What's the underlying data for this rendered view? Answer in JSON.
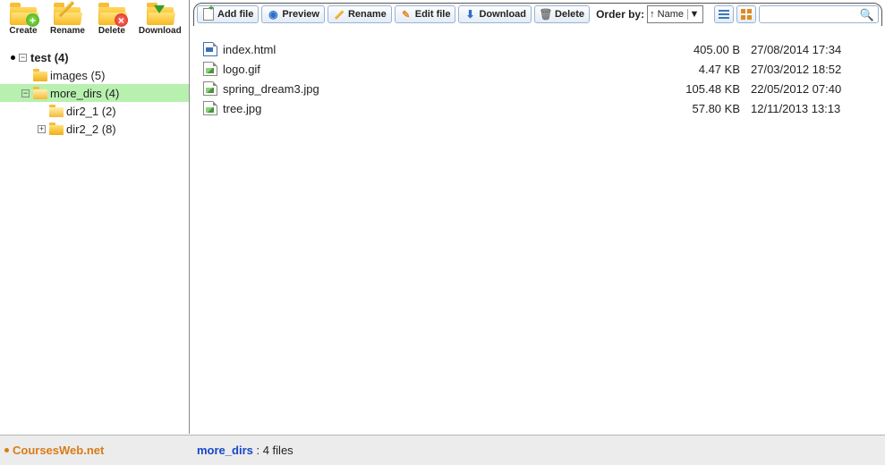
{
  "sidebar": {
    "buttons": [
      {
        "label": "Create",
        "icon": "folder-create"
      },
      {
        "label": "Rename",
        "icon": "folder-rename"
      },
      {
        "label": "Delete",
        "icon": "folder-delete"
      },
      {
        "label": "Download",
        "icon": "folder-download"
      }
    ],
    "tree": [
      {
        "depth": 0,
        "bullet": true,
        "expander": "minus",
        "folder": false,
        "label": "test (4)",
        "selected": false
      },
      {
        "depth": 1,
        "bullet": false,
        "expander": "none",
        "folder": true,
        "open": false,
        "label": "images (5)",
        "selected": false
      },
      {
        "depth": 1,
        "bullet": false,
        "expander": "minus",
        "folder": true,
        "open": true,
        "label": "more_dirs (4)",
        "selected": true
      },
      {
        "depth": 2,
        "bullet": false,
        "expander": "none",
        "folder": true,
        "open": true,
        "label": "dir2_1 (2)",
        "selected": false
      },
      {
        "depth": 2,
        "bullet": false,
        "expander": "plus",
        "folder": true,
        "open": false,
        "label": "dir2_2 (8)",
        "selected": false
      }
    ]
  },
  "toolbar": {
    "buttons": [
      {
        "label": "Add file",
        "icon": "addfile"
      },
      {
        "label": "Preview",
        "icon": "preview"
      },
      {
        "label": "Rename",
        "icon": "rename"
      },
      {
        "label": "Edit file",
        "icon": "edit"
      },
      {
        "label": "Download",
        "icon": "download"
      },
      {
        "label": "Delete",
        "icon": "delete"
      }
    ],
    "order_label": "Order by:",
    "order_value": "↑ Name",
    "search_placeholder": ""
  },
  "files": [
    {
      "name": "index.html",
      "size": "405.00 B",
      "date": "27/08/2014 17:34",
      "type": "html"
    },
    {
      "name": "logo.gif",
      "size": "4.47 KB",
      "date": "27/03/2012 18:52",
      "type": "img"
    },
    {
      "name": "spring_dream3.jpg",
      "size": "105.48 KB",
      "date": "22/05/2012 07:40",
      "type": "img"
    },
    {
      "name": "tree.jpg",
      "size": "57.80 KB",
      "date": "12/11/2013 13:13",
      "type": "img"
    }
  ],
  "status": {
    "site": "CoursesWeb.net",
    "dir": "more_dirs",
    "sep": " : ",
    "count": "4 files"
  }
}
